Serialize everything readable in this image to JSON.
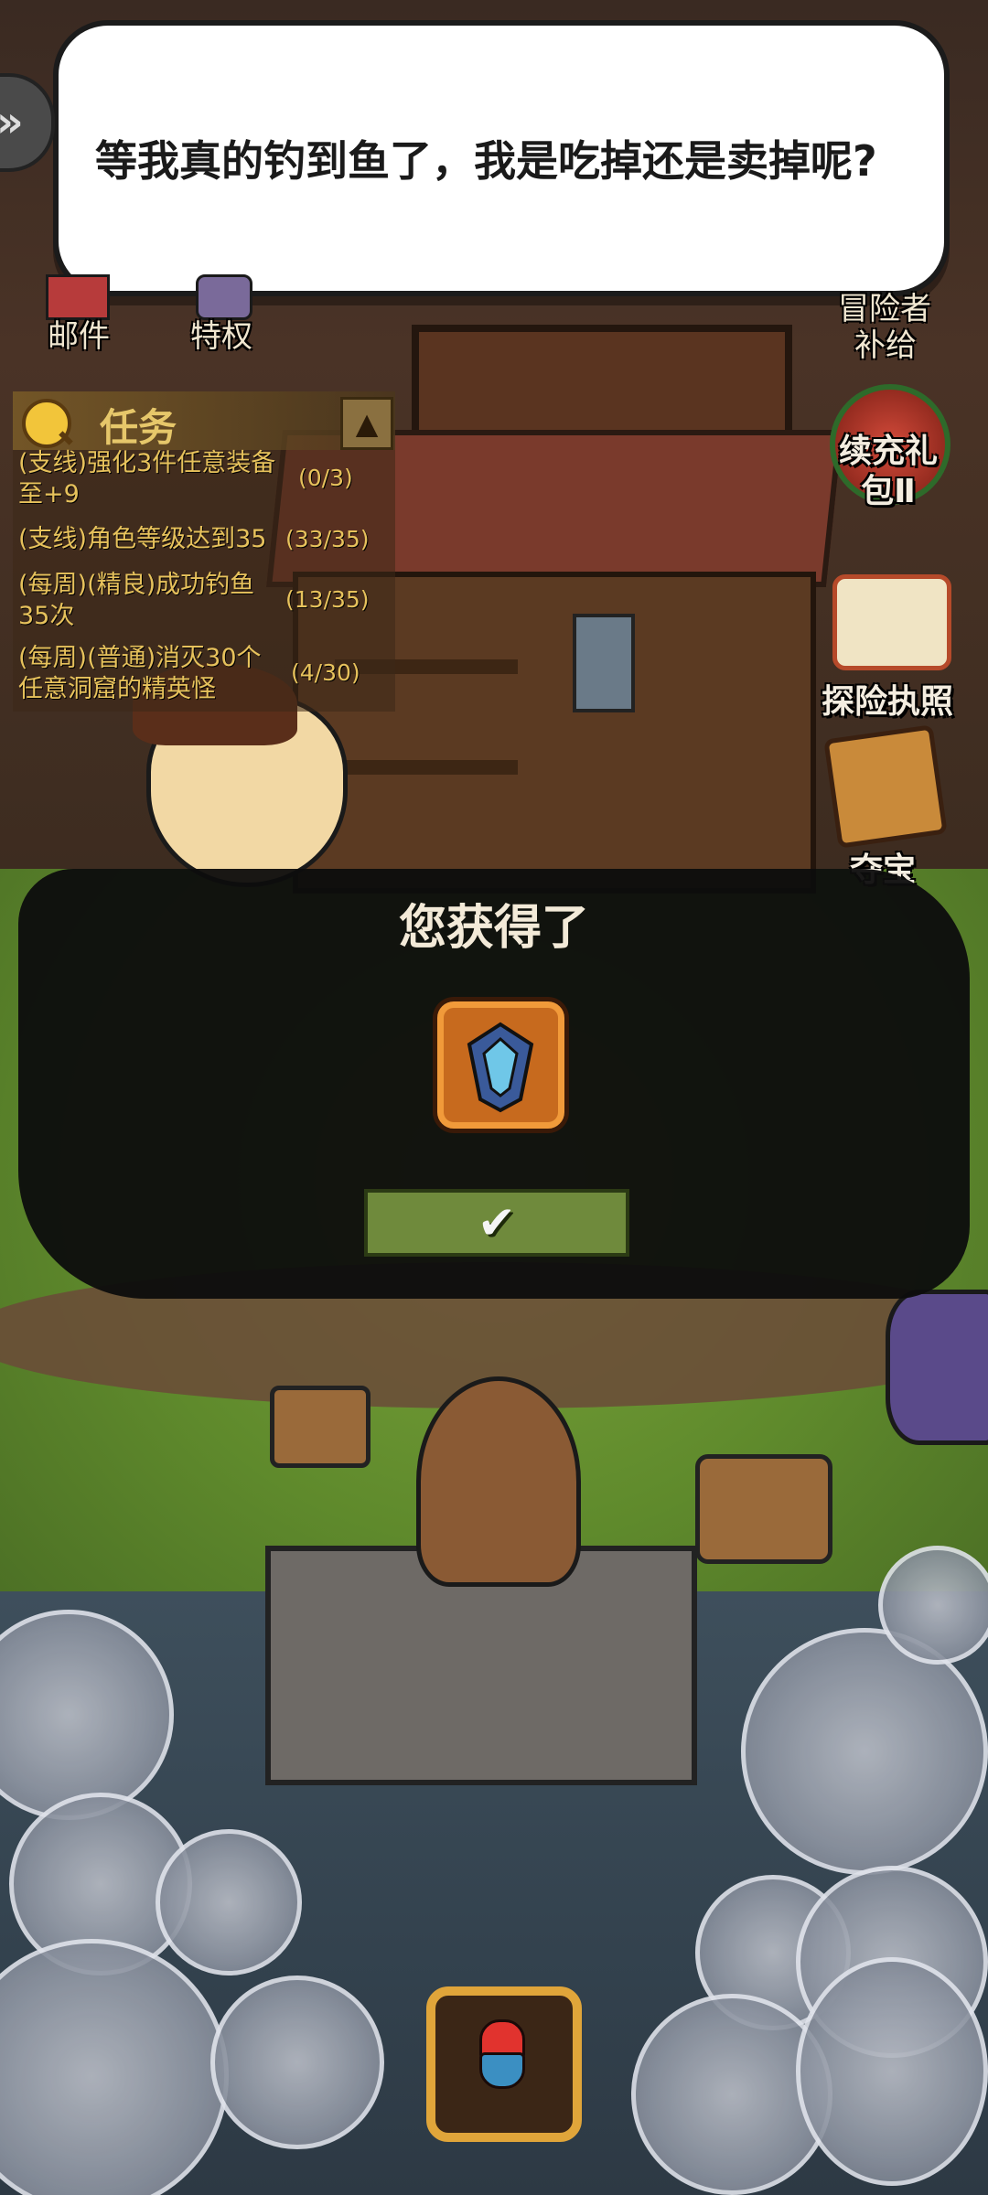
{
  "dialog": {
    "text": "等我真的钓到鱼了，我是吃掉还是卖掉呢?",
    "expand_arrow_glyph": "»"
  },
  "top_icons": {
    "mail_label": "邮件",
    "privilege_label": "特权",
    "adventurer_supply_label_1": "冒险者",
    "adventurer_supply_label_2": "补给"
  },
  "quest_panel": {
    "title": "任务",
    "items": [
      {
        "text": "(支线)强化3件任意装备至+9",
        "progress": "(0/3)"
      },
      {
        "text": "(支线)角色等级达到35",
        "progress": "(33/35)"
      },
      {
        "text": "(每周)(精良)成功钓鱼35次",
        "progress": "(13/35)"
      },
      {
        "text": "(每周)(普通)消灭30个任意洞窟的精英怪",
        "progress": "(4/30)"
      }
    ]
  },
  "right_menu": {
    "recharge_gift_label": "续充礼包Ⅱ",
    "license_label": "探险执照",
    "treasure_label": "夺宝"
  },
  "reward_popup": {
    "title": "您获得了",
    "confirm_glyph": "✔"
  },
  "colors": {
    "quest_text": "#e7c25c",
    "confirm_button": "#6f8a3c",
    "reward_frame": "#f19a3a"
  },
  "icons": [
    "expand-arrow-icon",
    "mail-icon",
    "privilege-icon",
    "search-icon",
    "collapse-up-icon",
    "gift-icon",
    "license-scroll-icon",
    "treasure-box-icon",
    "reward-item-icon",
    "checkmark-icon",
    "fishing-bobber-icon"
  ]
}
